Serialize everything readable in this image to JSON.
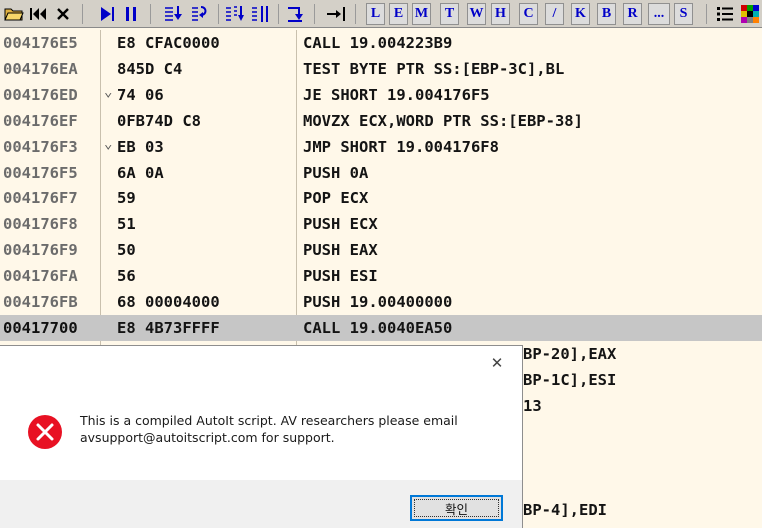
{
  "toolbar": {
    "letters": [
      "L",
      "E",
      "M",
      "T",
      "W",
      "H",
      "C",
      "/",
      "K",
      "B",
      "R",
      "...",
      "S"
    ],
    "accent_color": "#0000c8"
  },
  "disassembly": {
    "rows": [
      {
        "address": "004176E5",
        "hex": "E8 CFAC0000",
        "jump_mark": "",
        "asm": "CALL 19.004223B9",
        "selected": false
      },
      {
        "address": "004176EA",
        "hex": "845D C4",
        "jump_mark": "",
        "asm": "TEST BYTE PTR SS:[EBP-3C],BL",
        "selected": false
      },
      {
        "address": "004176ED",
        "hex": "74 06",
        "jump_mark": "⌄",
        "asm": "JE SHORT 19.004176F5",
        "selected": false
      },
      {
        "address": "004176EF",
        "hex": "0FB74D C8",
        "jump_mark": "",
        "asm": "MOVZX ECX,WORD PTR SS:[EBP-38]",
        "selected": false
      },
      {
        "address": "004176F3",
        "hex": "EB 03",
        "jump_mark": "⌄",
        "asm": "JMP SHORT 19.004176F8",
        "selected": false
      },
      {
        "address": "004176F5",
        "hex": "6A 0A",
        "jump_mark": "",
        "asm": "PUSH 0A",
        "selected": false
      },
      {
        "address": "004176F7",
        "hex": "59",
        "jump_mark": "",
        "asm": "POP ECX",
        "selected": false
      },
      {
        "address": "004176F8",
        "hex": "51",
        "jump_mark": "",
        "asm": "PUSH ECX",
        "selected": false
      },
      {
        "address": "004176F9",
        "hex": "50",
        "jump_mark": "",
        "asm": "PUSH EAX",
        "selected": false
      },
      {
        "address": "004176FA",
        "hex": "56",
        "jump_mark": "",
        "asm": "PUSH ESI",
        "selected": false
      },
      {
        "address": "004176FB",
        "hex": "68 00004000",
        "jump_mark": "",
        "asm": "PUSH 19.00400000",
        "selected": false
      },
      {
        "address": "00417700",
        "hex": "E8 4B73FFFF",
        "jump_mark": "",
        "asm": "CALL 19.0040EA50",
        "selected": true
      }
    ],
    "partial_rows": [
      "BP-20],EAX",
      "BP-1C],ESI",
      "13",
      "BP-4],EDI"
    ]
  },
  "dialog": {
    "message_line1": "This is a compiled AutoIt script. AV researchers please email",
    "message_line2": "avsupport@autoitscript.com for support.",
    "ok_label": "확인",
    "close_glyph": "✕",
    "icon": "error-icon",
    "error_color": "#e81123",
    "button_border_color": "#0078d7"
  }
}
